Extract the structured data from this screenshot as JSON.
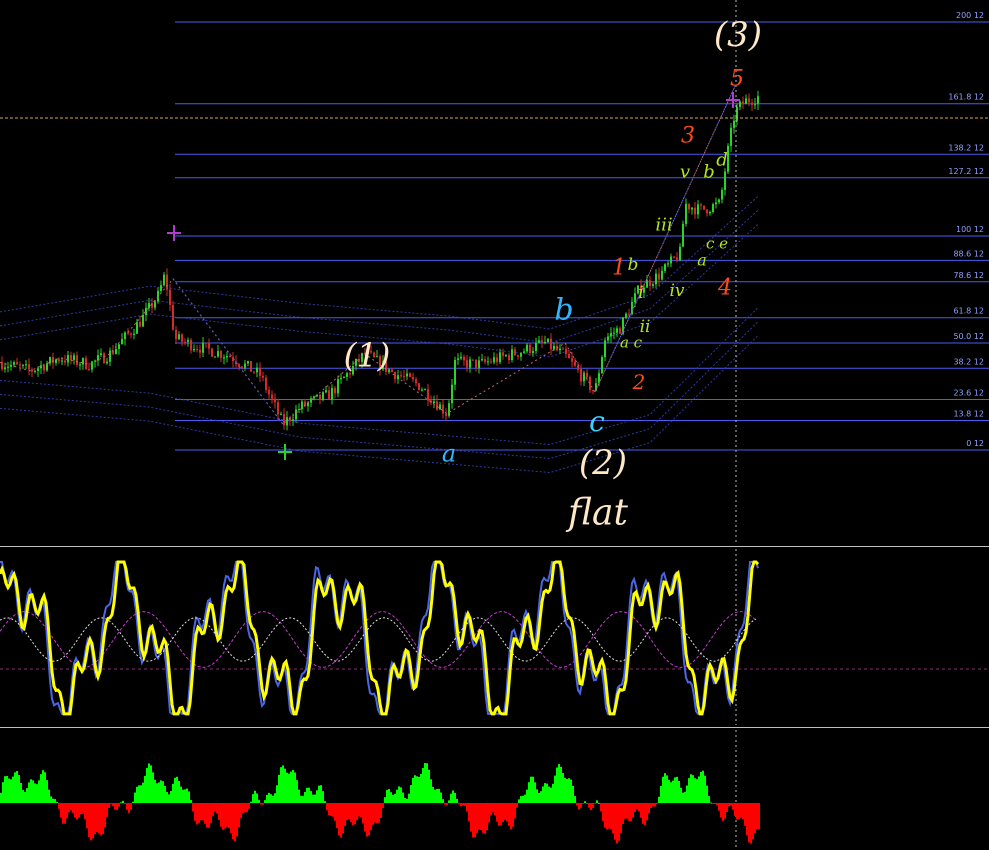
{
  "chart_data": [
    {
      "type": "candlestick",
      "fib_levels": [
        {
          "label": "200 12",
          "pct": 200
        },
        {
          "label": "161.8 12",
          "pct": 161.8
        },
        {
          "label": "138.2 12",
          "pct": 138.2
        },
        {
          "label": "127.2 12",
          "pct": 127.2
        },
        {
          "label": "100 12",
          "pct": 100
        },
        {
          "label": "88.6 12",
          "pct": 88.6
        },
        {
          "label": "78.6 12",
          "pct": 78.6
        },
        {
          "label": "61.8 12",
          "pct": 61.8
        },
        {
          "label": "50.0 12",
          "pct": 50.0
        },
        {
          "label": "38.2 12",
          "pct": 38.2
        },
        {
          "label": "23.6 12",
          "pct": 23.6
        },
        {
          "label": "13.8 12",
          "pct": 13.8
        },
        {
          "label": "0 12",
          "pct": 0
        }
      ],
      "wave_labels": [
        {
          "text": "(3)",
          "color": "#ffe8c8",
          "role": "degree"
        },
        {
          "text": "5",
          "color": "#ff4a1a",
          "role": "minor"
        },
        {
          "text": "3",
          "color": "#ff4a1a",
          "role": "minor"
        },
        {
          "text": "v",
          "color": "#b5e61d",
          "role": "minute"
        },
        {
          "text": "b",
          "color": "#b5e61d",
          "role": "minute"
        },
        {
          "text": "d",
          "color": "#b5e61d",
          "role": "minute"
        },
        {
          "text": "iii",
          "color": "#b5e61d",
          "role": "minute"
        },
        {
          "text": "c e",
          "color": "#b5e61d",
          "role": "minute"
        },
        {
          "text": "a",
          "color": "#b5e61d",
          "role": "minute"
        },
        {
          "text": "1",
          "color": "#ff4a1a",
          "role": "minor"
        },
        {
          "text": "b",
          "color": "#b5e61d",
          "role": "minute"
        },
        {
          "text": "i",
          "color": "#b5e61d",
          "role": "minute"
        },
        {
          "text": "iv",
          "color": "#b5e61d",
          "role": "minute"
        },
        {
          "text": "4",
          "color": "#ff4a1a",
          "role": "minor"
        },
        {
          "text": "ii",
          "color": "#b5e61d",
          "role": "minute"
        },
        {
          "text": "a c",
          "color": "#b5e61d",
          "role": "minute"
        },
        {
          "text": "b",
          "color": "#33b5ff",
          "role": "intermediate"
        },
        {
          "text": "(1)",
          "color": "#ffe8c8",
          "role": "degree"
        },
        {
          "text": "2",
          "color": "#ff4a1a",
          "role": "minor"
        },
        {
          "text": "c",
          "color": "#33d6ff",
          "role": "intermediate"
        },
        {
          "text": "a",
          "color": "#33b5ff",
          "role": "intermediate"
        },
        {
          "text": "(2)",
          "color": "#ffe8c8",
          "role": "degree"
        },
        {
          "text": "flat",
          "color": "#ffe8c8",
          "role": "annotation"
        }
      ],
      "price_path": [
        [
          0,
          41
        ],
        [
          30,
          37
        ],
        [
          60,
          43
        ],
        [
          90,
          40
        ],
        [
          110,
          45
        ],
        [
          140,
          60
        ],
        [
          158,
          72
        ],
        [
          165,
          82
        ],
        [
          175,
          52
        ],
        [
          200,
          48
        ],
        [
          230,
          44
        ],
        [
          260,
          35
        ],
        [
          283,
          12
        ],
        [
          300,
          20
        ],
        [
          330,
          26
        ],
        [
          365,
          45
        ],
        [
          390,
          37
        ],
        [
          420,
          30
        ],
        [
          447,
          17
        ],
        [
          455,
          41
        ],
        [
          480,
          40
        ],
        [
          520,
          46
        ],
        [
          545,
          50
        ],
        [
          565,
          44
        ],
        [
          595,
          27
        ],
        [
          605,
          52
        ],
        [
          620,
          57
        ],
        [
          640,
          76
        ],
        [
          660,
          82
        ],
        [
          680,
          92
        ],
        [
          685,
          115
        ],
        [
          700,
          112
        ],
        [
          720,
          115
        ],
        [
          728,
          140
        ],
        [
          735,
          158
        ],
        [
          745,
          163
        ],
        [
          758,
          165
        ]
      ],
      "bands": [
        {
          "name": "upper",
          "color": "#3a46c8",
          "points": [
            [
              0,
              58
            ],
            [
              150,
              70
            ],
            [
              300,
              62
            ],
            [
              450,
              56
            ],
            [
              550,
              50
            ],
            [
              650,
              66
            ],
            [
              758,
              112
            ]
          ]
        },
        {
          "name": "lower",
          "color": "#3a46c8",
          "points": [
            [
              0,
              26
            ],
            [
              150,
              20
            ],
            [
              300,
              6
            ],
            [
              450,
              0
            ],
            [
              550,
              -4
            ],
            [
              650,
              10
            ],
            [
              758,
              60
            ]
          ]
        }
      ],
      "colors": {
        "bull": "#2bd32b",
        "bear": "#d32b2b",
        "fib": "#4a5bf0",
        "current_price": "#d7a84a",
        "zigzag": "#b23bd0"
      }
    },
    {
      "type": "line",
      "series": [
        {
          "color": "#ffff00",
          "role": "fast"
        },
        {
          "color": "#4a66e6",
          "role": "slow"
        },
        {
          "color": "#e0e0e0",
          "role": "signal"
        },
        {
          "color": "#c23bd0",
          "role": "signal2"
        }
      ],
      "ylim": [
        0,
        100
      ]
    },
    {
      "type": "bar",
      "colors": {
        "positive": "#00ff00",
        "negative": "#ff0000"
      }
    }
  ]
}
